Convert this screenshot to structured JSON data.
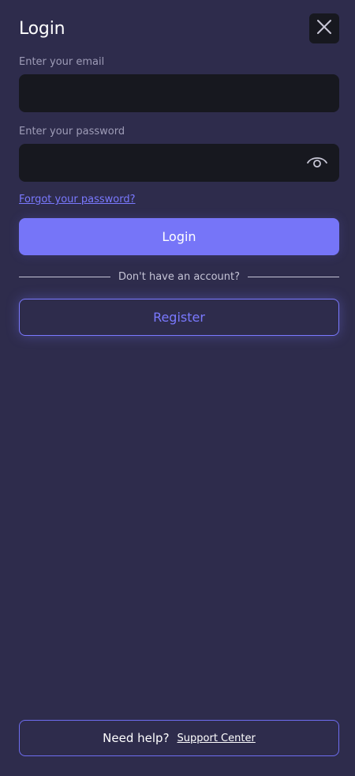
{
  "header": {
    "title": "Login",
    "close_icon": "close-icon"
  },
  "form": {
    "email_label": "Enter your email",
    "email_value": "",
    "email_placeholder": "",
    "password_label": "Enter your password",
    "password_value": "",
    "password_placeholder": "",
    "password_toggle_icon": "eye-icon",
    "forgot_link": "Forgot your password?",
    "login_button": "Login"
  },
  "divider": {
    "text": "Don't have an account?"
  },
  "register": {
    "button": "Register"
  },
  "footer": {
    "help_text": "Need help?",
    "support_link": "Support Center"
  },
  "colors": {
    "background": "#2e2c4c",
    "input_background": "#17181f",
    "accent": "#7675f8",
    "link": "#7a79ff",
    "muted_text": "#9e9cb7"
  }
}
